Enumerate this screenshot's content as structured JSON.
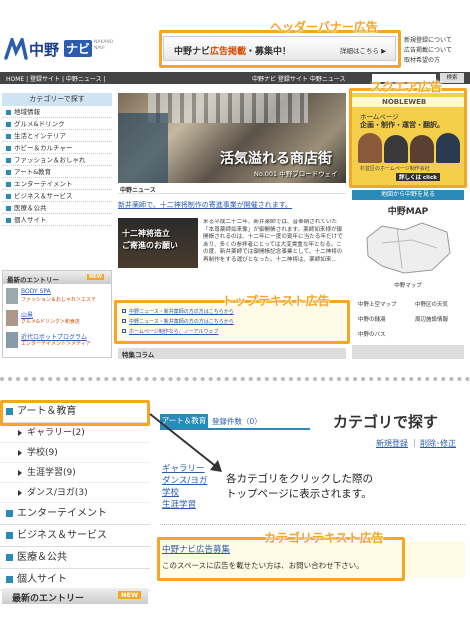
{
  "callouts": {
    "header_banner": "ヘッダーバナー広告",
    "square": "スクエア広告",
    "top_text": "トップテキスト広告",
    "category_text": "カテゴリテキスト広告"
  },
  "header": {
    "logo_main": "中野",
    "logo_badge": "ナビ",
    "logo_sub": "NAKANO NAVI",
    "banner_left": "中野ナビ",
    "banner_highlight": "広告掲載",
    "banner_rest": "・募集中！",
    "banner_details": "詳細はこちら ▶",
    "right_links": [
      "新規登録について",
      "広告掲載について",
      "取材希望の方"
    ]
  },
  "navbar": {
    "left": "HOME | 登録サイト | 中野ニュース |",
    "right": "中野ナビ 登録サイト 中野ニュース",
    "search_label": "検索"
  },
  "sidebar": {
    "title": "カテゴリーで探す",
    "items": [
      "地域情報",
      "グルメ&ドリンク",
      "生活とインテリア",
      "ホビー＆カルチャー",
      "ファッション＆おしゃれ",
      "アート&教育",
      "エンターテイメント",
      "ビジネス＆サービス",
      "医療＆公共",
      "個人サイト"
    ],
    "new_entries_title": "最新のエントリー",
    "new_badge": "NEW",
    "entries": [
      {
        "title": "BODY SPA",
        "sub": "ファッション＆おしゃれ＞エステ"
      },
      {
        "title": "山景",
        "sub": "グルメ&ドリンク＞和食店"
      },
      {
        "title": "近代ロボットプログラム",
        "sub": "エンターテイメント＞メディア"
      }
    ]
  },
  "main": {
    "hero_text": "活気溢れる商店街",
    "hero_sub": "No.001 中野ブロードウェイ",
    "news_tag": "中野ニュース",
    "headline": "新井薬師で、十二神将制作の寄進事業が開催されます。",
    "thumb_text": "十二神将造立\nご寄進のお願い",
    "body": "来る平成二十二年、新井薬師では、昔奉納されていた「本尊薬師如来像」が御開帳されます。薬師如来様が御開帳されるのは、十二年に一度の寅年に当たる年だけであり、多くの参拝者にとっては大変貴重な年となる。この度、新井薬師では御開帳記念事業として、十二神将の再制作をする運びとなった。十二神将は、薬師如来...",
    "text_ads": [
      "中野ニュース・新井薬師の方の方はこちらから",
      "中野ニュース・新井薬師の方の方はこちらから",
      "ホームページ制作なら、ノーアルウェブ"
    ],
    "feature_title": "特集コラム"
  },
  "right": {
    "square_brand": "NOBLEWEB",
    "square_l1": "ホームページ",
    "square_l2": "企画・制作・運営・翻訳。",
    "square_company": "杉並区のホームページ制作会社",
    "square_click": "詳しくは click",
    "map_header": "地図から中野を見る",
    "map_title": "中野MAP",
    "map_caption": "中野マップ",
    "links": [
      "中野上空マップ",
      "中野区の天気",
      "中野の銭湯",
      "周辺施設情報",
      "中野のバス"
    ]
  },
  "category": {
    "menu": [
      {
        "label": "アート＆教育",
        "count": ""
      },
      {
        "label": "ギャラリー",
        "count": "(2)"
      },
      {
        "label": "学校",
        "count": "(9)"
      },
      {
        "label": "生涯学習",
        "count": "(9)"
      },
      {
        "label": "ダンス/ヨガ",
        "count": "(3)"
      },
      {
        "label": "エンターテイメント",
        "count": ""
      },
      {
        "label": "ビジネス＆サービス",
        "count": ""
      },
      {
        "label": "医療＆公共",
        "count": ""
      },
      {
        "label": "個人サイト",
        "count": ""
      }
    ],
    "new_entries": "最新のエントリー",
    "new_badge": "NEW",
    "tab": "アート＆教育",
    "reg_count": "登録件数（0）",
    "big_title": "カテゴリで探す",
    "links_right": [
      "新規登録",
      "削除･修正"
    ],
    "sub_links": [
      "ギャラリー",
      "ダンス/ヨガ",
      "学校",
      "生涯学習"
    ],
    "explain": "各カテゴリをクリックした際の\nトップページに表示されます。",
    "ad_title": "中野ナビ広告募集",
    "ad_body": "このスペースに広告を載せたい方は、お問い合わせ下さい。"
  }
}
